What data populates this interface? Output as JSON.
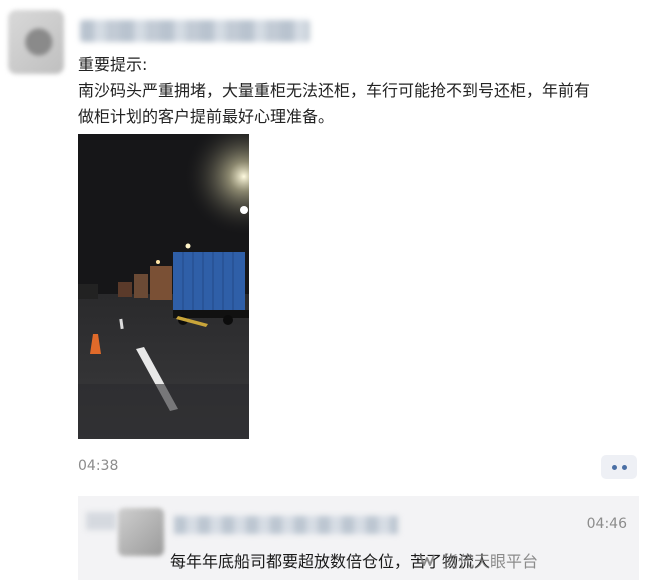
{
  "post": {
    "line1": "重要提示:",
    "line2": "南沙码头严重拥堵，大量重柜无法还柜，车行可能抢不到号还柜，年前有",
    "line3": "做柜计划的客户提前最好心理准备。",
    "time": "04:38"
  },
  "comment": {
    "time": "04:46",
    "text": "每年年底船司都要超放数倍仓位，苦了物流人"
  },
  "watermark": {
    "text": "货代天眼平台",
    "icon": "wechat-channel-icon"
  },
  "colors": {
    "link_dots": "#4a6fa5",
    "comment_bg": "#f3f3f5",
    "container_blue": "#2f5fa8"
  }
}
